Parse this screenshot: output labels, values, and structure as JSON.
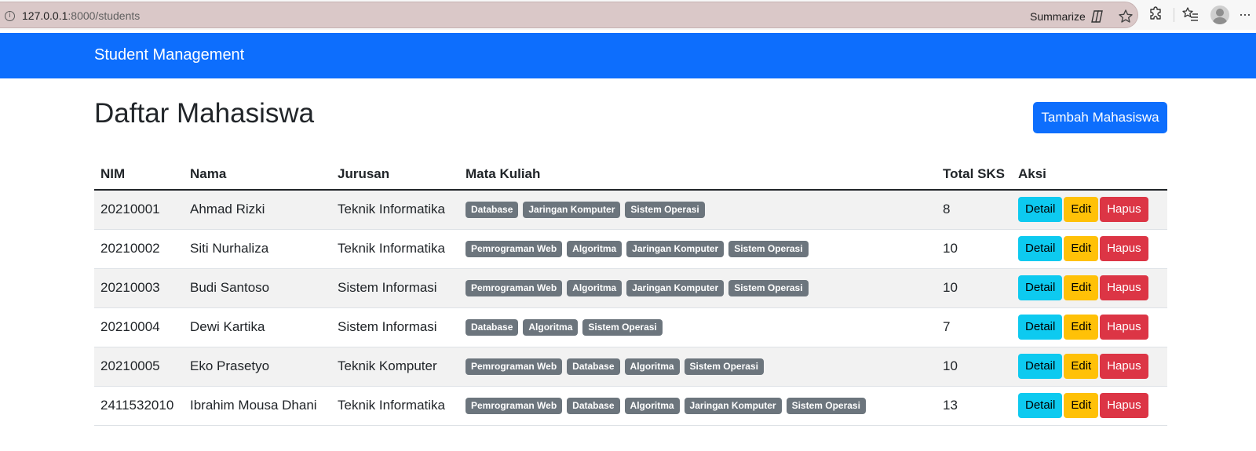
{
  "browser": {
    "url_host": "127.0.0.1",
    "url_path": ":8000/students",
    "summarize_label": "Summarize"
  },
  "navbar": {
    "brand": "Student Management"
  },
  "header": {
    "title": "Daftar Mahasiswa",
    "add_button": "Tambah Mahasiswa"
  },
  "table": {
    "columns": [
      "NIM",
      "Nama",
      "Jurusan",
      "Mata Kuliah",
      "Total SKS",
      "Aksi"
    ],
    "rows": [
      {
        "nim": "20210001",
        "nama": "Ahmad Rizki",
        "jurusan": "Teknik Informatika",
        "mata_kuliah": [
          "Database",
          "Jaringan Komputer",
          "Sistem Operasi"
        ],
        "sks": "8"
      },
      {
        "nim": "20210002",
        "nama": "Siti Nurhaliza",
        "jurusan": "Teknik Informatika",
        "mata_kuliah": [
          "Pemrograman Web",
          "Algoritma",
          "Jaringan Komputer",
          "Sistem Operasi"
        ],
        "sks": "10"
      },
      {
        "nim": "20210003",
        "nama": "Budi Santoso",
        "jurusan": "Sistem Informasi",
        "mata_kuliah": [
          "Pemrograman Web",
          "Algoritma",
          "Jaringan Komputer",
          "Sistem Operasi"
        ],
        "sks": "10"
      },
      {
        "nim": "20210004",
        "nama": "Dewi Kartika",
        "jurusan": "Sistem Informasi",
        "mata_kuliah": [
          "Database",
          "Algoritma",
          "Sistem Operasi"
        ],
        "sks": "7"
      },
      {
        "nim": "20210005",
        "nama": "Eko Prasetyo",
        "jurusan": "Teknik Komputer",
        "mata_kuliah": [
          "Pemrograman Web",
          "Database",
          "Algoritma",
          "Sistem Operasi"
        ],
        "sks": "10"
      },
      {
        "nim": "2411532010",
        "nama": "Ibrahim Mousa Dhani",
        "jurusan": "Teknik Informatika",
        "mata_kuliah": [
          "Pemrograman Web",
          "Database",
          "Algoritma",
          "Jaringan Komputer",
          "Sistem Operasi"
        ],
        "sks": "13"
      }
    ],
    "actions": {
      "detail": "Detail",
      "edit": "Edit",
      "hapus": "Hapus"
    }
  },
  "colors": {
    "primary": "#0d6efd",
    "badge": "#6c757d",
    "info": "#0dcaf0",
    "warning": "#ffc107",
    "danger": "#dc3545"
  }
}
